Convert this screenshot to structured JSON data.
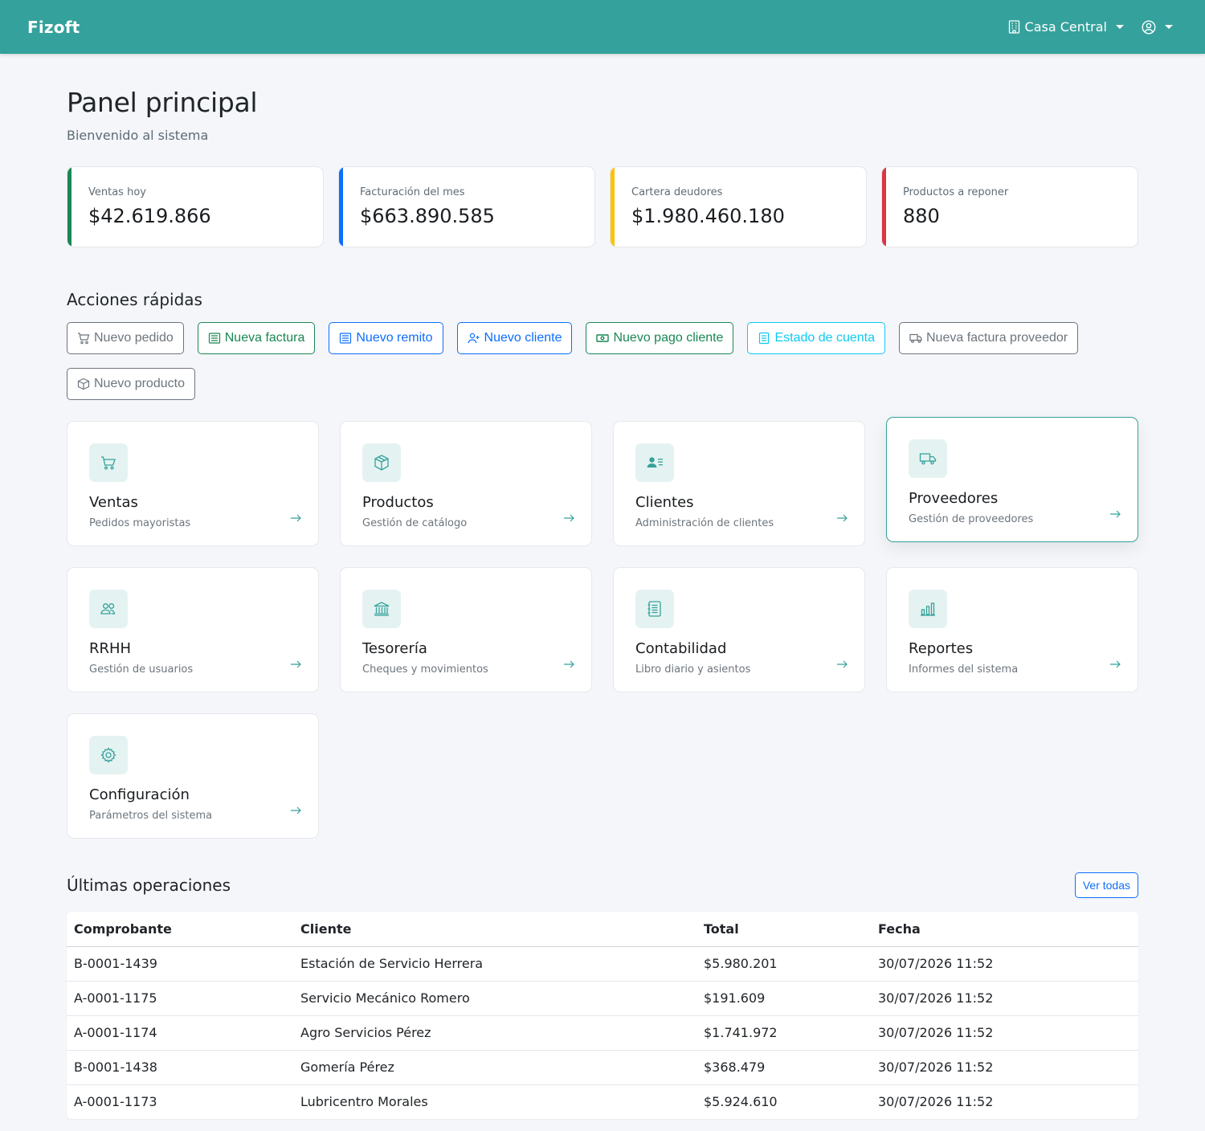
{
  "navbar": {
    "brand": "Fizoft",
    "branch": "Casa Central",
    "branch_icon": "building-icon",
    "user_icon": "user-circle-icon"
  },
  "page": {
    "title": "Panel principal",
    "subtitle": "Bienvenido al sistema"
  },
  "stats": [
    {
      "label": "Ventas hoy",
      "value": "$42.619.866",
      "color": "#198754"
    },
    {
      "label": "Facturación del mes",
      "value": "$663.890.585",
      "color": "#0d6efd"
    },
    {
      "label": "Cartera deudores",
      "value": "$1.980.460.180",
      "color": "#ffc107"
    },
    {
      "label": "Productos a reponer",
      "value": "880",
      "color": "#dc3545"
    }
  ],
  "quick_actions": {
    "title": "Acciones rápidas",
    "items": [
      {
        "label": "Nuevo pedido",
        "icon": "cart-icon",
        "color": "#6c757d"
      },
      {
        "label": "Nueva factura",
        "icon": "receipt-icon",
        "color": "#198754"
      },
      {
        "label": "Nuevo remito",
        "icon": "document-icon",
        "color": "#0d6efd"
      },
      {
        "label": "Nuevo cliente",
        "icon": "person-plus-icon",
        "color": "#0d6efd"
      },
      {
        "label": "Nuevo pago cliente",
        "icon": "cash-icon",
        "color": "#198754"
      },
      {
        "label": "Estado de cuenta",
        "icon": "list-icon",
        "color": "#0dcaf0"
      },
      {
        "label": "Nueva factura proveedor",
        "icon": "truck-icon",
        "color": "#6c757d"
      },
      {
        "label": "Nuevo producto",
        "icon": "box-icon",
        "color": "#6c757d"
      }
    ]
  },
  "modules": [
    {
      "title": "Ventas",
      "subtitle": "Pedidos mayoristas",
      "icon": "cart-icon"
    },
    {
      "title": "Productos",
      "subtitle": "Gestión de catálogo",
      "icon": "box-icon"
    },
    {
      "title": "Clientes",
      "subtitle": "Administración de clientes",
      "icon": "person-lines-icon"
    },
    {
      "title": "Proveedores",
      "subtitle": "Gestión de proveedores",
      "icon": "truck-icon"
    },
    {
      "title": "RRHH",
      "subtitle": "Gestión de usuarios",
      "icon": "people-icon"
    },
    {
      "title": "Tesorería",
      "subtitle": "Cheques y movimientos",
      "icon": "bank-icon"
    },
    {
      "title": "Contabilidad",
      "subtitle": "Libro diario y asientos",
      "icon": "journal-icon"
    },
    {
      "title": "Reportes",
      "subtitle": "Informes del sistema",
      "icon": "bar-chart-icon"
    },
    {
      "title": "Configuración",
      "subtitle": "Parámetros del sistema",
      "icon": "gear-icon"
    }
  ],
  "operations": {
    "title": "Últimas operaciones",
    "view_all": "Ver todas",
    "columns": [
      "Comprobante",
      "Cliente",
      "Total",
      "Fecha"
    ],
    "rows": [
      [
        "B-0001-1439",
        "Estación de Servicio Herrera",
        "$5.980.201",
        "30/07/2026 11:52"
      ],
      [
        "A-0001-1175",
        "Servicio Mecánico Romero",
        "$191.609",
        "30/07/2026 11:52"
      ],
      [
        "A-0001-1174",
        "Agro Servicios Pérez",
        "$1.741.972",
        "30/07/2026 11:52"
      ],
      [
        "B-0001-1438",
        "Gomería Pérez",
        "$368.479",
        "30/07/2026 11:52"
      ],
      [
        "A-0001-1173",
        "Lubricentro Morales",
        "$5.924.610",
        "30/07/2026 11:52"
      ]
    ]
  }
}
